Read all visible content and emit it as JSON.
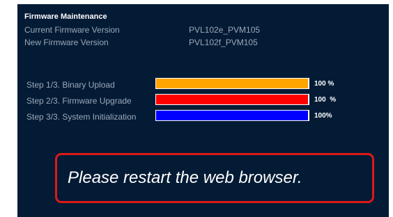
{
  "panel": {
    "title": "Firmware Maintenance",
    "current_version_label": "Current Firmware Version",
    "current_version_value": "PVL102e_PVM105",
    "new_version_label": "New Firmware Version",
    "new_version_value": "PVL102f_PVM105"
  },
  "steps": [
    {
      "label": "Step 1/3. Binary Upload",
      "progress": 1.0,
      "percent_text": "100 %",
      "color": "#ffa500"
    },
    {
      "label": "Step 2/3. Firmware Upgrade",
      "progress": 1.0,
      "percent_text": "100  %",
      "color": "#ff0000"
    },
    {
      "label": "Step 3/3. System Initialization",
      "progress": 1.0,
      "percent_text": "100%",
      "color": "#0000ff"
    }
  ],
  "notice": {
    "text": "Please restart the web browser.",
    "border_color": "#e01818"
  },
  "colors": {
    "background": "#041b35",
    "label_text": "#9aa9ba",
    "title_text": "#ffffff"
  }
}
